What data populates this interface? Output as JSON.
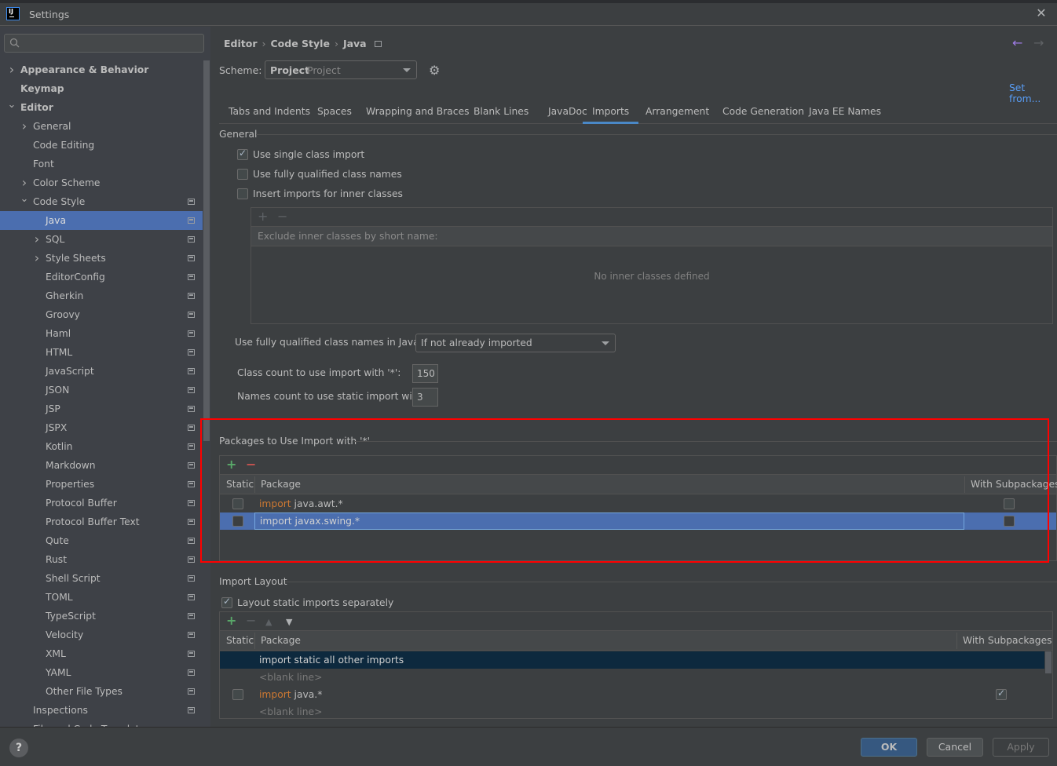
{
  "window": {
    "title": "Settings",
    "logo_text": "IJ"
  },
  "sidebar": {
    "search_placeholder": "",
    "items": [
      {
        "label": "Appearance & Behavior",
        "level": 0,
        "chevron": "right",
        "bold": true,
        "project_icon": false,
        "selected": false
      },
      {
        "label": "Keymap",
        "level": 0,
        "chevron": "none",
        "bold": true,
        "project_icon": false,
        "selected": false
      },
      {
        "label": "Editor",
        "level": 0,
        "chevron": "down",
        "bold": true,
        "project_icon": false,
        "selected": false
      },
      {
        "label": "General",
        "level": 1,
        "chevron": "right",
        "bold": false,
        "project_icon": false,
        "selected": false
      },
      {
        "label": "Code Editing",
        "level": 1,
        "chevron": "none",
        "bold": false,
        "project_icon": false,
        "selected": false
      },
      {
        "label": "Font",
        "level": 1,
        "chevron": "none",
        "bold": false,
        "project_icon": false,
        "selected": false
      },
      {
        "label": "Color Scheme",
        "level": 1,
        "chevron": "right",
        "bold": false,
        "project_icon": false,
        "selected": false
      },
      {
        "label": "Code Style",
        "level": 1,
        "chevron": "down",
        "bold": false,
        "project_icon": true,
        "selected": false
      },
      {
        "label": "Java",
        "level": 2,
        "chevron": "none",
        "bold": false,
        "project_icon": true,
        "selected": true
      },
      {
        "label": "SQL",
        "level": 2,
        "chevron": "right",
        "bold": false,
        "project_icon": true,
        "selected": false
      },
      {
        "label": "Style Sheets",
        "level": 2,
        "chevron": "right",
        "bold": false,
        "project_icon": true,
        "selected": false
      },
      {
        "label": "EditorConfig",
        "level": 2,
        "chevron": "none",
        "bold": false,
        "project_icon": true,
        "selected": false
      },
      {
        "label": "Gherkin",
        "level": 2,
        "chevron": "none",
        "bold": false,
        "project_icon": true,
        "selected": false
      },
      {
        "label": "Groovy",
        "level": 2,
        "chevron": "none",
        "bold": false,
        "project_icon": true,
        "selected": false
      },
      {
        "label": "Haml",
        "level": 2,
        "chevron": "none",
        "bold": false,
        "project_icon": true,
        "selected": false
      },
      {
        "label": "HTML",
        "level": 2,
        "chevron": "none",
        "bold": false,
        "project_icon": true,
        "selected": false
      },
      {
        "label": "JavaScript",
        "level": 2,
        "chevron": "none",
        "bold": false,
        "project_icon": true,
        "selected": false
      },
      {
        "label": "JSON",
        "level": 2,
        "chevron": "none",
        "bold": false,
        "project_icon": true,
        "selected": false
      },
      {
        "label": "JSP",
        "level": 2,
        "chevron": "none",
        "bold": false,
        "project_icon": true,
        "selected": false
      },
      {
        "label": "JSPX",
        "level": 2,
        "chevron": "none",
        "bold": false,
        "project_icon": true,
        "selected": false
      },
      {
        "label": "Kotlin",
        "level": 2,
        "chevron": "none",
        "bold": false,
        "project_icon": true,
        "selected": false
      },
      {
        "label": "Markdown",
        "level": 2,
        "chevron": "none",
        "bold": false,
        "project_icon": true,
        "selected": false
      },
      {
        "label": "Properties",
        "level": 2,
        "chevron": "none",
        "bold": false,
        "project_icon": true,
        "selected": false
      },
      {
        "label": "Protocol Buffer",
        "level": 2,
        "chevron": "none",
        "bold": false,
        "project_icon": true,
        "selected": false
      },
      {
        "label": "Protocol Buffer Text",
        "level": 2,
        "chevron": "none",
        "bold": false,
        "project_icon": true,
        "selected": false
      },
      {
        "label": "Qute",
        "level": 2,
        "chevron": "none",
        "bold": false,
        "project_icon": true,
        "selected": false
      },
      {
        "label": "Rust",
        "level": 2,
        "chevron": "none",
        "bold": false,
        "project_icon": true,
        "selected": false
      },
      {
        "label": "Shell Script",
        "level": 2,
        "chevron": "none",
        "bold": false,
        "project_icon": true,
        "selected": false
      },
      {
        "label": "TOML",
        "level": 2,
        "chevron": "none",
        "bold": false,
        "project_icon": true,
        "selected": false
      },
      {
        "label": "TypeScript",
        "level": 2,
        "chevron": "none",
        "bold": false,
        "project_icon": true,
        "selected": false
      },
      {
        "label": "Velocity",
        "level": 2,
        "chevron": "none",
        "bold": false,
        "project_icon": true,
        "selected": false
      },
      {
        "label": "XML",
        "level": 2,
        "chevron": "none",
        "bold": false,
        "project_icon": true,
        "selected": false
      },
      {
        "label": "YAML",
        "level": 2,
        "chevron": "none",
        "bold": false,
        "project_icon": true,
        "selected": false
      },
      {
        "label": "Other File Types",
        "level": 2,
        "chevron": "none",
        "bold": false,
        "project_icon": true,
        "selected": false
      },
      {
        "label": "Inspections",
        "level": 1,
        "chevron": "none",
        "bold": false,
        "project_icon": true,
        "selected": false
      },
      {
        "label": "File and Code Templates",
        "level": 1,
        "chevron": "none",
        "bold": false,
        "project_icon": false,
        "selected": false
      }
    ]
  },
  "header": {
    "breadcrumb": [
      "Editor",
      "Code Style",
      "Java"
    ],
    "scheme_label": "Scheme:",
    "scheme_value": "Project",
    "scheme_sub": "Project",
    "set_from": "Set from..."
  },
  "tabs": [
    {
      "label": "Tabs and Indents",
      "active": false
    },
    {
      "label": "Spaces",
      "active": false
    },
    {
      "label": "Wrapping and Braces",
      "active": false
    },
    {
      "label": "Blank Lines",
      "active": false
    },
    {
      "label": "JavaDoc",
      "active": false
    },
    {
      "label": "Imports",
      "active": true
    },
    {
      "label": "Arrangement",
      "active": false
    },
    {
      "label": "Code Generation",
      "active": false
    },
    {
      "label": "Java EE Names",
      "active": false
    }
  ],
  "general": {
    "title": "General",
    "options": [
      {
        "label": "Use single class import",
        "checked": true
      },
      {
        "label": "Use fully qualified class names",
        "checked": false
      },
      {
        "label": "Insert imports for inner classes",
        "checked": false
      }
    ],
    "inner_classes": {
      "add": "+",
      "remove": "−",
      "header": "Exclude inner classes by short name:",
      "empty": "No inner classes defined"
    },
    "javadoc_label": "Use fully qualified class names in JavaDoc:",
    "javadoc_value": "If not already imported",
    "class_count_label": "Class count to use import with '*':",
    "class_count_value": "150",
    "names_count_label": "Names count to use static import with '*':",
    "names_count_value": "3"
  },
  "packages": {
    "title": "Packages to Use Import with '*'",
    "add": "+",
    "remove": "−",
    "columns": [
      "Static",
      "Package",
      "With Subpackages"
    ],
    "rows": [
      {
        "static": false,
        "keyword": "import",
        "package": "java.awt.*",
        "with_subpackages": false,
        "selected": false
      },
      {
        "static": false,
        "keyword": "import",
        "package": "javax.swing.*",
        "with_subpackages": false,
        "selected": true
      }
    ]
  },
  "import_layout": {
    "title": "Import Layout",
    "separate_label": "Layout static imports separately",
    "separate_checked": true,
    "columns": [
      "Static",
      "Package",
      "With Subpackages"
    ],
    "rows": [
      {
        "type": "entry",
        "text": "import static all other imports",
        "selected": true
      },
      {
        "type": "blank",
        "text": "<blank line>"
      },
      {
        "type": "package",
        "keyword": "import",
        "package": "java.*",
        "static": false,
        "with_subpackages": true
      },
      {
        "type": "blank",
        "text": "<blank line>"
      }
    ]
  },
  "footer": {
    "help": "?",
    "ok": "OK",
    "cancel": "Cancel",
    "apply": "Apply"
  },
  "colors": {
    "accent": "#4b6eaf",
    "link": "#589df6",
    "keyword": "#cc7832",
    "highlight_border": "#ff0000"
  }
}
